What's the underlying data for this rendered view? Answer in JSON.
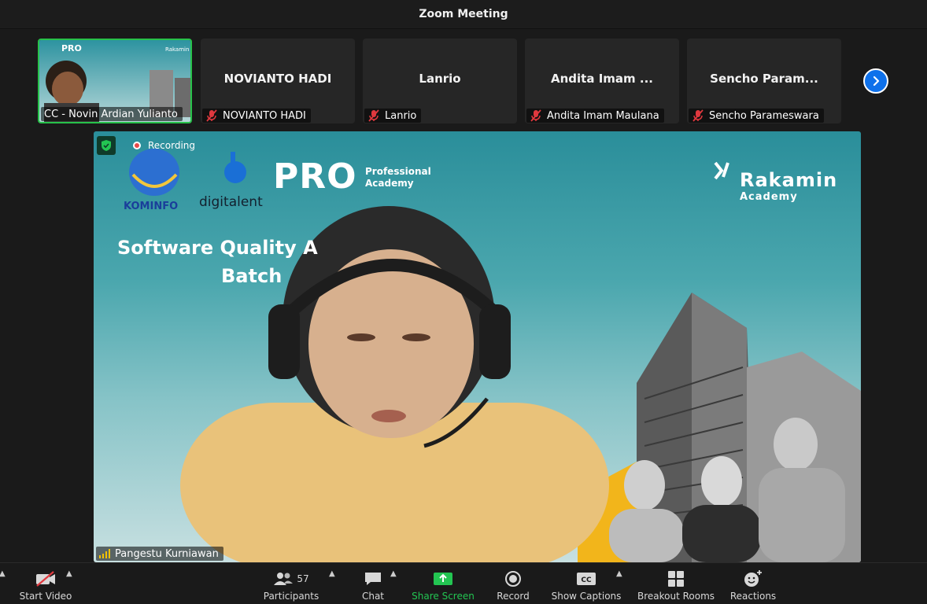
{
  "window": {
    "title": "Zoom Meeting"
  },
  "thumbnails": [
    {
      "type": "video",
      "label": "CC - Novin Ardian Yulianto",
      "muted": false
    },
    {
      "type": "name",
      "display_name": "NOVIANTO HADI",
      "label": "NOVIANTO HADI",
      "muted": true
    },
    {
      "type": "name",
      "display_name": "Lanrio",
      "label": "Lanrio",
      "muted": true
    },
    {
      "type": "name",
      "display_name": "Andita Imam ...",
      "label": "Andita Imam Maulana",
      "muted": true
    },
    {
      "type": "name",
      "display_name": "Sencho Param...",
      "label": "Sencho Parameswara",
      "muted": true
    }
  ],
  "main_video": {
    "recording_label": "Recording",
    "speaker_name": "Pangestu Kurniawan",
    "slide": {
      "kominfo": "KOMINFO",
      "digitalent": "digitalent",
      "pro": "PRO",
      "pro_sub_1": "Professional",
      "pro_sub_2": "Academy",
      "rakamin_name": "Rakamin",
      "rakamin_sub": "Academy",
      "title": "Software Quality A",
      "batch": "Batch"
    }
  },
  "toolbar": {
    "start_video": "Start Video",
    "participants_label": "Participants",
    "participants_count": "57",
    "chat": "Chat",
    "share_screen": "Share Screen",
    "record": "Record",
    "show_captions": "Show Captions",
    "breakout_rooms": "Breakout Rooms",
    "reactions": "Reactions"
  },
  "colors": {
    "share_green": "#23c552",
    "accent_blue": "#0e71eb",
    "muted_red": "#e0383e",
    "active_speaker_border": "#27c24a"
  }
}
